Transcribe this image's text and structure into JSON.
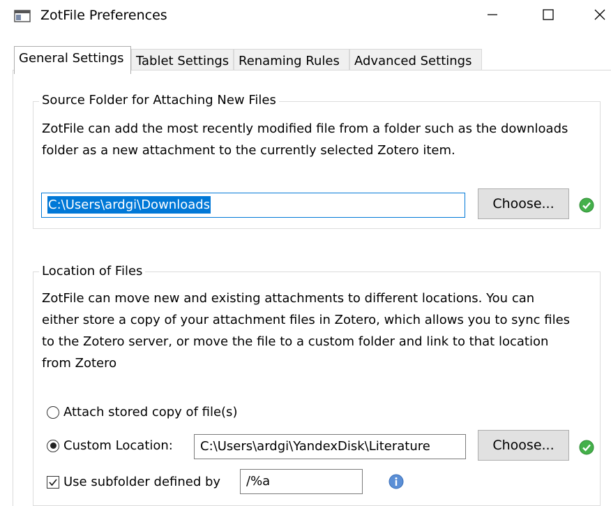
{
  "window": {
    "title": "ZotFile Preferences",
    "icon": "app-window-icon",
    "controls": {
      "minimize": "minimize-icon",
      "maximize": "maximize-icon",
      "close": "close-icon"
    }
  },
  "tabs": [
    {
      "label": "General Settings",
      "active": true
    },
    {
      "label": "Tablet Settings",
      "active": false
    },
    {
      "label": "Renaming Rules",
      "active": false
    },
    {
      "label": "Advanced Settings",
      "active": false
    }
  ],
  "source_folder": {
    "legend": "Source Folder for Attaching New Files",
    "description_line1": "ZotFile can add the most recently modified file from a folder such as the downloads",
    "description_line2": "folder as a new attachment to the currently selected Zotero item.",
    "path_value": "C:\\Users\\ardgi\\Downloads",
    "choose_label": "Choose...",
    "status": "valid-check-icon"
  },
  "location": {
    "legend": "Location of Files",
    "description_line1": "ZotFile can move new and existing attachments to different locations. You can",
    "description_line2": "either store a copy of your attachment files in Zotero, which allows you to sync files",
    "description_line3": "to the Zotero server, or move the file to a custom folder and link to that location",
    "description_line4": "from Zotero",
    "option_stored": "Attach stored copy of file(s)",
    "option_stored_selected": false,
    "option_custom": "Custom Location:",
    "option_custom_selected": true,
    "custom_path_value": "C:\\Users\\ardgi\\YandexDisk\\Literature",
    "choose_label": "Choose...",
    "status": "valid-check-icon",
    "subfolder_label": "Use subfolder defined by",
    "subfolder_checked": true,
    "subfolder_value": "/%a",
    "info": "info-icon"
  },
  "colors": {
    "accent": "#0078d7",
    "check_green": "#2ea043",
    "info_blue": "#4a86c8"
  }
}
